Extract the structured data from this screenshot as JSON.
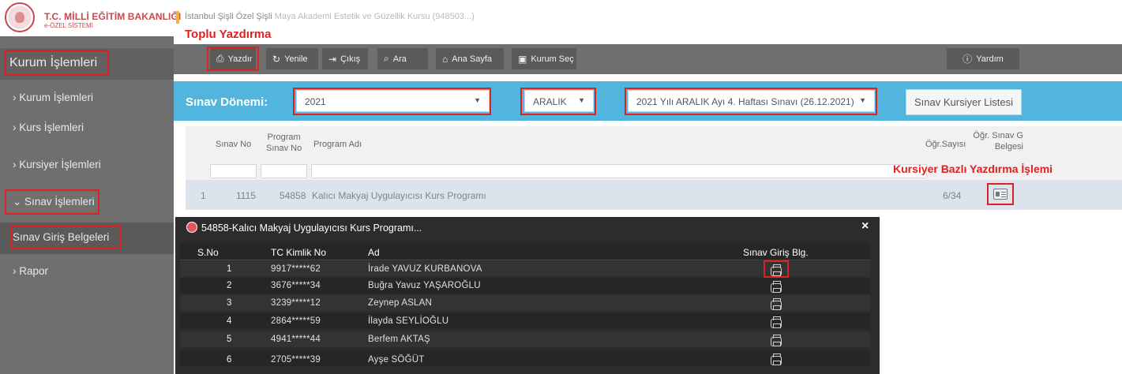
{
  "header": {
    "ministry_name": "T.C. MİLLİ EĞİTİM BAKANLIĞI",
    "system_name": "e-ÖZEL SİSTEMİ",
    "institution_prefix": "İstanbul Şişli Özel Şişli",
    "institution_rest": "Maya Akademi Estetik ve Güzellik Kursu (948503...)"
  },
  "annotations": {
    "bulk_print": "Toplu Yazdırma",
    "per_trainee_print": "Kursiyer Bazlı Yazdırma İşlemi"
  },
  "sidebar": {
    "title": "Kurum İşlemleri",
    "items": [
      {
        "label": "› Kurum İşlemleri"
      },
      {
        "label": "› Kurs İşlemleri"
      },
      {
        "label": "› Kursiyer İşlemleri"
      },
      {
        "label": "⌄ Sınav İşlemleri"
      },
      {
        "label": "Sınav Giriş Belgeleri"
      },
      {
        "label": "› Rapor"
      }
    ]
  },
  "toolbar": {
    "print": "Yazdır",
    "refresh": "Yenile",
    "exit": "Çıkış",
    "search": "Ara",
    "home": "Ana Sayfa",
    "select_institution": "Kurum Seç",
    "help": "Yardım"
  },
  "filters": {
    "label": "Sınav Dönemi:",
    "year": "2021",
    "month": "ARALIK",
    "exam": "2021 Yılı ARALIK  Ayı 4. Haftası Sınavı (26.12.2021)",
    "list_button": "Sınav Kursiyer Listesi"
  },
  "grid": {
    "headers": {
      "exam_no": "Sınav No",
      "program_exam_no_1": "Program",
      "program_exam_no_2": "Sınav No",
      "program_name": "Program Adı",
      "trainee_count": "Öğr.Sayısı",
      "doc_1": "Öğr. Sınav G",
      "doc_2": "Belgesi"
    },
    "rows": [
      {
        "index": "1",
        "exam_no": "1115",
        "program_exam_no": "54858",
        "program_name": "Kalıcı Makyaj Uygulayıcısı Kurs Programı",
        "trainee_count": "6/34"
      }
    ]
  },
  "modal": {
    "title": "54858-Kalıcı Makyaj Uygulayıcısı Kurs Programı...",
    "close": "×",
    "headers": {
      "no": "S.No",
      "tc": "TC Kimlik No",
      "name": "Ad",
      "doc": "Sınav Giriş Blg."
    },
    "rows": [
      {
        "no": "1",
        "tc": "9917*****62",
        "name": "İrade YAVUZ KURBANOVA"
      },
      {
        "no": "2",
        "tc": "3676*****34",
        "name": "Buğra Yavuz YAŞAROĞLU"
      },
      {
        "no": "3",
        "tc": "3239*****12",
        "name": "Zeynep ASLAN"
      },
      {
        "no": "4",
        "tc": "2864*****59",
        "name": "İlayda SEYLİOĞLU"
      },
      {
        "no": "5",
        "tc": "4941*****44",
        "name": "Berfem AKTAŞ"
      },
      {
        "no": "6",
        "tc": "2705*****39",
        "name": "Ayşe SÖĞÜT"
      }
    ]
  }
}
